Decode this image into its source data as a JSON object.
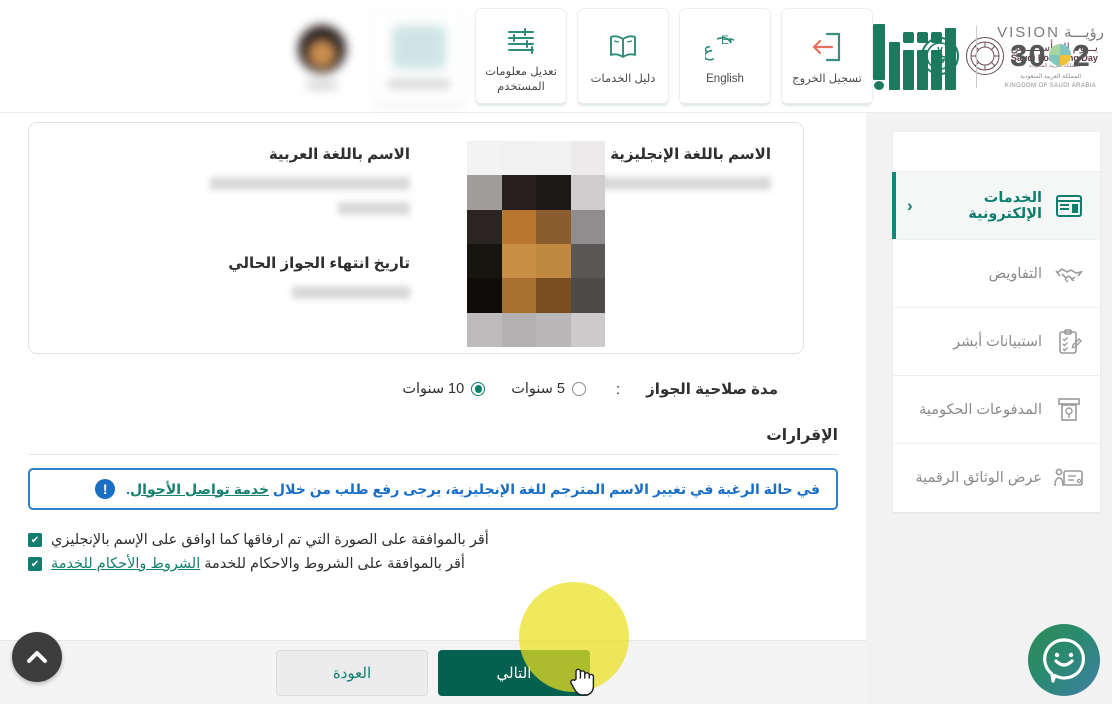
{
  "header": {
    "founding_day": {
      "arabic": "يـــوم الـتـأســيــس",
      "english": "Saudi Founding Day",
      "sub": "المملكة العربية السعودية",
      "seal_icon": "founding-day-seal-icon",
      "emblem_icon": "saudi-emblem-icon"
    },
    "tiles": [
      {
        "label": "تسجيل الخروج",
        "icon": "logout-icon",
        "blurred": false
      },
      {
        "label": "English",
        "icon": "language-toggle-icon",
        "blurred": false
      },
      {
        "label": "دليل الخدمات",
        "icon": "services-guide-book-icon",
        "blurred": false
      },
      {
        "label": "تعديل معلومات المستخدم",
        "icon": "user-settings-sliders-icon",
        "blurred": false
      }
    ],
    "blurred_tile": {
      "label": "",
      "icon": "blurred-tile-icon"
    },
    "avatar": {
      "label": "",
      "icon": "user-avatar-icon"
    },
    "vision": {
      "top": "VISION",
      "top_ar": "رؤيـــة",
      "number_left": "2",
      "number_right": "30",
      "sub_ar": "المملكة العربية السعودية",
      "sub_en": "KINGDOM OF SAUDI ARABIA"
    },
    "absher_logo_name": "absher-logo"
  },
  "sidebar": {
    "items": [
      {
        "label": "الخدمات الإلكترونية",
        "icon": "electronic-services-icon",
        "active": true,
        "chevron": "‹"
      },
      {
        "label": "التفاويض",
        "icon": "handshake-delegations-icon",
        "active": false
      },
      {
        "label": "استبيانات أبشر",
        "icon": "clipboard-surveys-icon",
        "active": false
      },
      {
        "label": "المدفوعات الحكومية",
        "icon": "government-payments-icon",
        "active": false
      },
      {
        "label": "عرض الوثائق الرقمية",
        "icon": "digital-documents-icon",
        "active": false
      }
    ]
  },
  "form": {
    "fields": {
      "name_en_label": "الاسم باللغة الإنجليزية",
      "name_ar_label": "الاسم باللغة العربية",
      "passport_expiry_label": "تاريخ انتهاء الجواز الحالي",
      "name_en_value": "",
      "name_ar_value": "",
      "passport_expiry_value": ""
    },
    "photo": {
      "name": "applicant-photo-pixelated"
    },
    "validity": {
      "label": "مدة صلاحية الجواز",
      "colon": ":",
      "options": [
        {
          "label": "5 سنوات",
          "selected": false
        },
        {
          "label": "10 سنوات",
          "selected": true
        }
      ]
    },
    "declarations": {
      "title": "الإقرارات",
      "alert": {
        "icon": "info-exclamation-icon",
        "text_before": "في حالة الرغبة في تغيير الاسم المترجم للغة الإنجليزية، يرجى رفع طلب من خلال ",
        "link": "خدمة تواصل الأحوال",
        "text_after": "."
      },
      "checkboxes": [
        {
          "text": "أقر بالموافقة على الصورة التي تم ارفاقها كما اوافق على الإسم بالإنجليزي",
          "checked": true,
          "checkmark": "✔",
          "link": ""
        },
        {
          "text_before": "أقر بالموافقة على الشروط والاحكام للخدمة ",
          "link": "الشروط والأحكام للخدمة",
          "checked": true,
          "checkmark": "✔"
        }
      ]
    },
    "buttons": {
      "next": "التالي",
      "back": "العودة"
    }
  },
  "widgets": {
    "scroll_top": {
      "icon": "chevron-up-icon",
      "glyph": "⌃"
    },
    "chatbot": {
      "icon": "chatbot-smiley-icon"
    }
  },
  "colors": {
    "brand_green": "#0e7f6d",
    "dark_green": "#05614f",
    "alert_blue": "#1a6fc4",
    "link_green": "#17806f",
    "highlight_yellow": "#ece01f",
    "scrollbar_teal": "#0d7d71"
  }
}
